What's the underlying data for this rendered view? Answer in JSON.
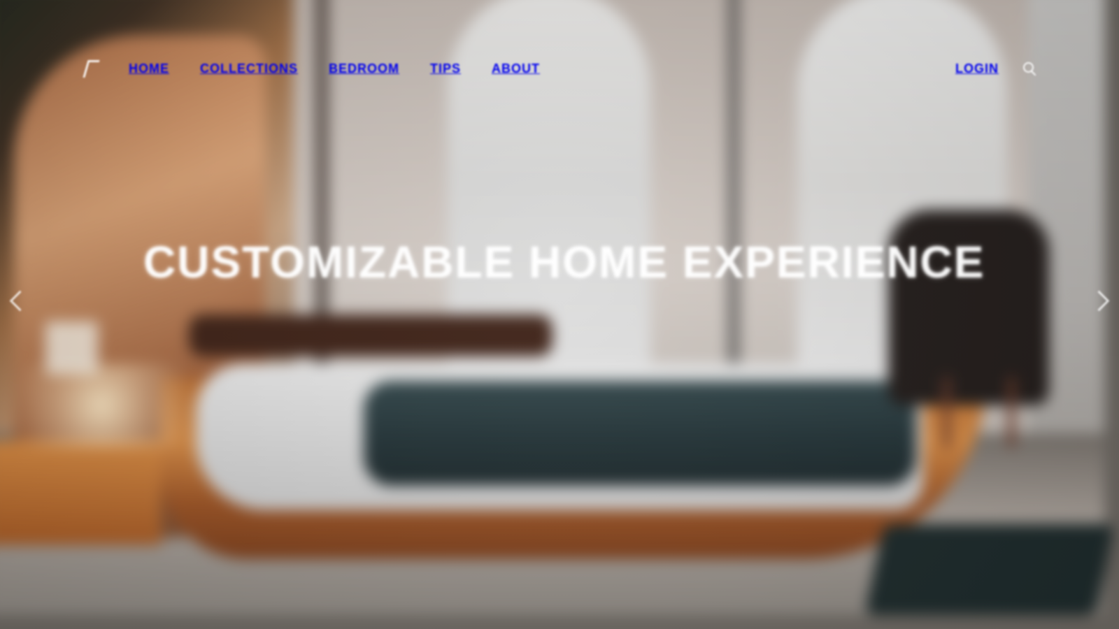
{
  "navigation": {
    "left_items": [
      {
        "label": "",
        "icon": "logo-mark"
      },
      {
        "label": "Home"
      },
      {
        "label": "Collections"
      },
      {
        "label": "Bedroom"
      },
      {
        "label": "Tips"
      },
      {
        "label": "About"
      }
    ],
    "right_items": [
      {
        "label": "Login"
      },
      {
        "label": "",
        "icon": "search-icon"
      }
    ]
  },
  "hero": {
    "title": "CUSTOMIZABLE HOME EXPERIENCE",
    "subtitle": ""
  },
  "controls": {
    "prev_icon": "chevron-left-icon",
    "next_icon": "chevron-right-icon"
  },
  "colors": {
    "text": "#ffffff",
    "wood": "#c97a3b",
    "blanket": "#243438",
    "wall": "#d4ccc6"
  }
}
